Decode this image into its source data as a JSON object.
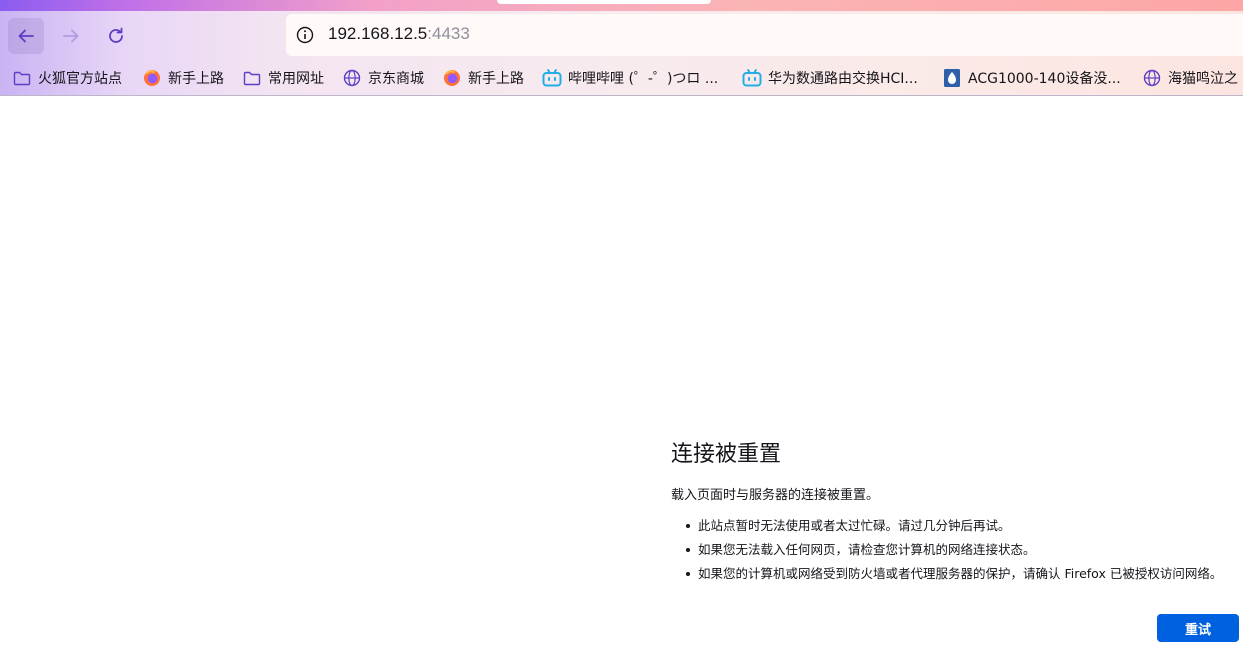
{
  "browser": {
    "url_host": "192.168.12.5",
    "url_port": ":4433"
  },
  "bookmarks": [
    {
      "label": "火狐官方站点",
      "icon": "folder-icon"
    },
    {
      "label": "新手上路",
      "icon": "firefox-icon"
    },
    {
      "label": "常用网址",
      "icon": "folder-icon"
    },
    {
      "label": "京东商城",
      "icon": "globe-icon"
    },
    {
      "label": "新手上路",
      "icon": "firefox-icon"
    },
    {
      "label": "哔哩哔哩 (゜-゜)つロ ...",
      "icon": "bilibili-icon"
    },
    {
      "label": "华为数通路由交换HCI...",
      "icon": "bilibili-icon"
    },
    {
      "label": "ACG1000-140设备没...",
      "icon": "document-icon"
    },
    {
      "label": "海猫鸣泣之",
      "icon": "globe-icon"
    }
  ],
  "error": {
    "title": "连接被重置",
    "description": "载入页面时与服务器的连接被重置。",
    "items": [
      "此站点暂时无法使用或者太过忙碌。请过几分钟后再试。",
      "如果您无法载入任何网页，请检查您计算机的网络连接状态。",
      "如果您的计算机或网络受到防火墙或者代理服务器的保护，请确认 Firefox 已被授权访问网络。"
    ],
    "retry_label": "重试"
  },
  "colors": {
    "accent": "#0061e0",
    "nav_icon": "#5b3fc4",
    "bilibili": "#23ade5"
  }
}
